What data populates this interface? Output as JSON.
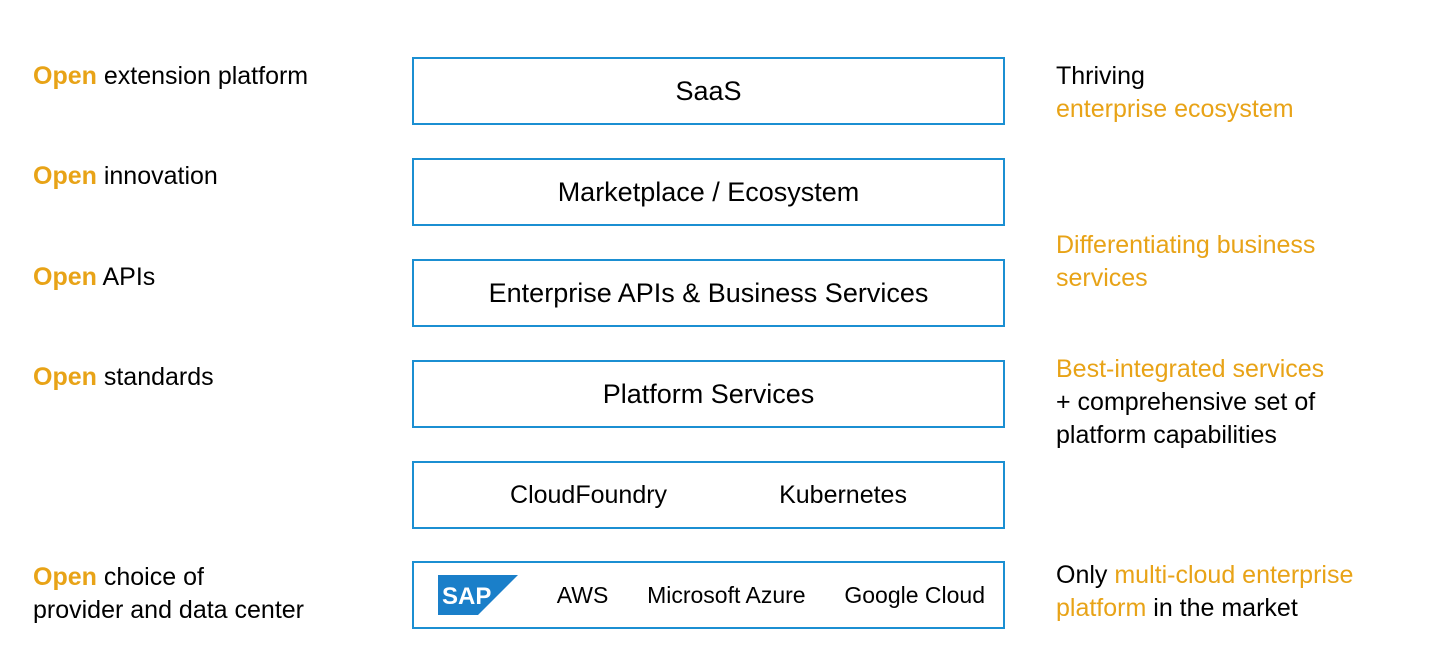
{
  "colors": {
    "accent": "#E8A317",
    "box_border": "#1B8FD2",
    "sap_logo": "#1A7FC9"
  },
  "left_labels": [
    {
      "open": "Open",
      "rest": " extension platform"
    },
    {
      "open": "Open",
      "rest": " innovation"
    },
    {
      "open": "Open",
      "rest": " APIs"
    },
    {
      "open": "Open",
      "rest": " standards"
    },
    {
      "open": "Open",
      "rest": " choice of",
      "line2": "provider and data center"
    }
  ],
  "layers": {
    "saas": "SaaS",
    "marketplace": "Marketplace / Ecosystem",
    "enterprise_apis": "Enterprise APIs & Business Services",
    "platform_services": "Platform Services",
    "runtimes": [
      "CloudFoundry",
      "Kubernetes"
    ],
    "providers": {
      "logo_text": "SAP",
      "items": [
        "AWS",
        "Microsoft Azure",
        "Google Cloud"
      ]
    }
  },
  "right_labels": {
    "ecosystem": {
      "line1": "Thriving",
      "line2": "enterprise ecosystem"
    },
    "business": {
      "line1": "Differentiating business",
      "line2": "services"
    },
    "integrated": {
      "line1": "Best-integrated services",
      "line2": "+ comprehensive set of",
      "line3": "platform capabilities"
    },
    "multicloud": {
      "prefix": "Only ",
      "accent1": "multi-cloud enterprise",
      "accent2": "platform",
      "suffix": " in the market"
    }
  }
}
